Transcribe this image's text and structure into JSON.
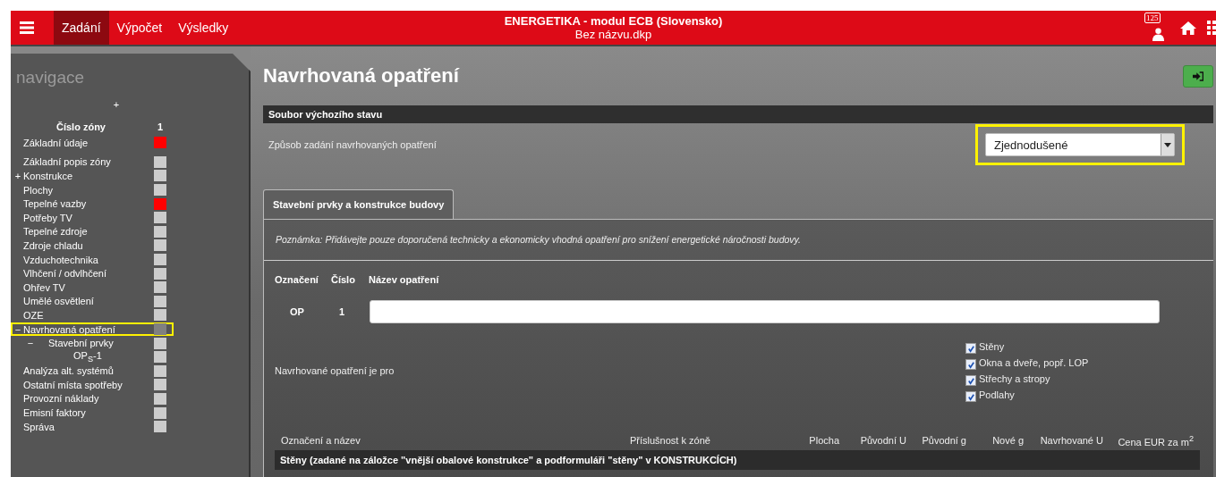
{
  "topbar": {
    "menu": [
      {
        "label": "Zadání",
        "selected": true
      },
      {
        "label": "Výpočet",
        "selected": false
      },
      {
        "label": "Výsledky",
        "selected": false
      }
    ],
    "title": "ENERGETIKA - modul ECB (Slovensko)",
    "subtitle": "Bez názvu.dkp",
    "badge": "125"
  },
  "sidebar": {
    "title": "navigace",
    "add": "+",
    "zone_label": "Číslo zóny",
    "zone_number": "1",
    "items": [
      {
        "label": "Základní údaje",
        "color": "#ff0000",
        "selected": false
      },
      {
        "label": "Základní popis zóny",
        "color": "#cccccc",
        "selected": false
      },
      {
        "label": "Konstrukce",
        "color": "#cccccc",
        "selected": false,
        "toggle": "+"
      },
      {
        "label": "Plochy",
        "color": "#cccccc",
        "selected": false
      },
      {
        "label": "Tepelné vazby",
        "color": "#ff0000",
        "selected": false
      },
      {
        "label": "Potřeby TV",
        "color": "#cccccc",
        "selected": false
      },
      {
        "label": "Tepelné zdroje",
        "color": "#cccccc",
        "selected": false
      },
      {
        "label": "Zdroje chladu",
        "color": "#cccccc",
        "selected": false
      },
      {
        "label": "Vzduchotechnika",
        "color": "#cccccc",
        "selected": false
      },
      {
        "label": "Vlhčení / odvlhčení",
        "color": "#cccccc",
        "selected": false
      },
      {
        "label": "Ohřev TV",
        "color": "#cccccc",
        "selected": false
      },
      {
        "label": "Umělé osvětlení",
        "color": "#cccccc",
        "selected": false
      },
      {
        "label": "OZE",
        "color": "#cccccc",
        "selected": false
      },
      {
        "label": "Navrhovaná opatření",
        "color": "#808080",
        "selected": true,
        "toggle": "−",
        "children": [
          {
            "label": "Stavební prvky",
            "color": "#cccccc",
            "selected": false,
            "toggle": "−",
            "children": [
              {
                "label": "OP$_{S}$-1",
                "color": "#cccccc",
                "selected": false
              }
            ]
          }
        ]
      },
      {
        "label": "Analýza alt. systémů",
        "color": "#cccccc",
        "selected": false
      },
      {
        "label": "Ostatní místa spotřeby",
        "color": "#cccccc",
        "selected": false
      },
      {
        "label": "Provozní náklady",
        "color": "#cccccc",
        "selected": false
      },
      {
        "label": "Emisní faktory",
        "color": "#cccccc",
        "selected": false
      },
      {
        "label": "Správa",
        "color": "#cccccc",
        "selected": false
      }
    ]
  },
  "page_title": "Navrhovaná opatření",
  "section_header": "Soubor výchozího stavu",
  "mode_label": "Způsob zadání navrhovaných opatření",
  "mode_select": {
    "value": "Zjednodušené"
  },
  "tabs": [
    {
      "label": "Stavební prvky a konstrukce budovy",
      "selected": true
    }
  ],
  "note": "Poznámka: Přidávejte pouze doporučená technicky a ekonomicky vhodná opatření pro snížení energetické náročnosti budovy.",
  "measure_columns": [
    "Označení",
    "Číslo",
    "Název opatření"
  ],
  "measure": {
    "code": "OP",
    "number": "1"
  },
  "applies_label": "Navrhované opatření je pro",
  "applies": [
    {
      "label": "Stěny",
      "checked": true
    },
    {
      "label": "Okna a dveře, popř. LOP",
      "checked": true
    },
    {
      "label": "Střechy a stropy",
      "checked": true
    },
    {
      "label": "Podlahy",
      "checked": true
    }
  ],
  "table": {
    "columns": [
      "Označení a název",
      "Příslušnost k zóně",
      "Plocha",
      "Původní U",
      "Původní g",
      "Nové g",
      "Navrhované U",
      "Cena EUR za m$^{2}$"
    ],
    "group": "Stěny (zadané na záložce \"vnější obalové konstrukce\" a podformuláři \"stěny\" v KONSTRUKCÍCH)"
  }
}
